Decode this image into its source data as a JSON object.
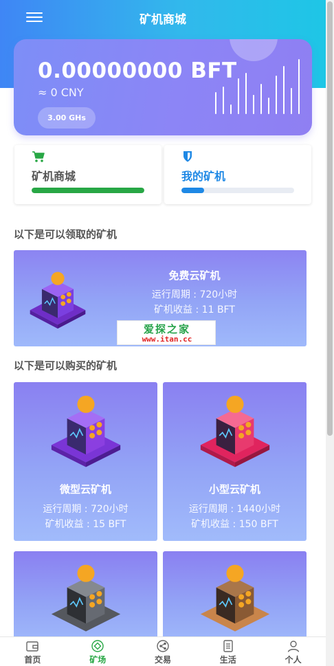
{
  "header": {
    "title": "矿机商城"
  },
  "balance": {
    "amount": "0.00000000 BFT",
    "cny": "≈ 0 CNY",
    "hashrate": "3.00 GHs"
  },
  "tabs": [
    {
      "label": "矿机商城",
      "color": "#28a745",
      "progress": 1.0,
      "icon": "cart-icon"
    },
    {
      "label": "我的矿机",
      "color": "#1e88e5",
      "progress": 0.2,
      "icon": "shield-icon"
    }
  ],
  "sections": {
    "claimable": "以下是可以领取的矿机",
    "purchasable": "以下是可以购买的矿机"
  },
  "free_miner": {
    "name": "免费云矿机",
    "period": "运行周期 : 720小时",
    "income": "矿机收益 : 11 BFT"
  },
  "watermark": {
    "text": "爱探之家",
    "url": "www.itan.cc"
  },
  "miners": [
    {
      "name": "微型云矿机",
      "period": "运行周期 : 720小时",
      "income": "矿机收益 : 15 BFT",
      "color": "#8b3fe0"
    },
    {
      "name": "小型云矿机",
      "period": "运行周期 : 1440小时",
      "income": "矿机收益 : 150 BFT",
      "color": "#e0245e"
    },
    {
      "name": "",
      "period": "",
      "income": "",
      "color": "#666a72"
    },
    {
      "name": "",
      "period": "",
      "income": "",
      "color": "#c9854b"
    }
  ],
  "bottom_nav": [
    {
      "label": "首页",
      "icon": "wallet-icon",
      "active": false
    },
    {
      "label": "矿场",
      "icon": "target-icon",
      "active": true
    },
    {
      "label": "交易",
      "icon": "share-icon",
      "active": false
    },
    {
      "label": "生活",
      "icon": "document-icon",
      "active": false
    },
    {
      "label": "个人",
      "icon": "user-icon",
      "active": false
    }
  ]
}
